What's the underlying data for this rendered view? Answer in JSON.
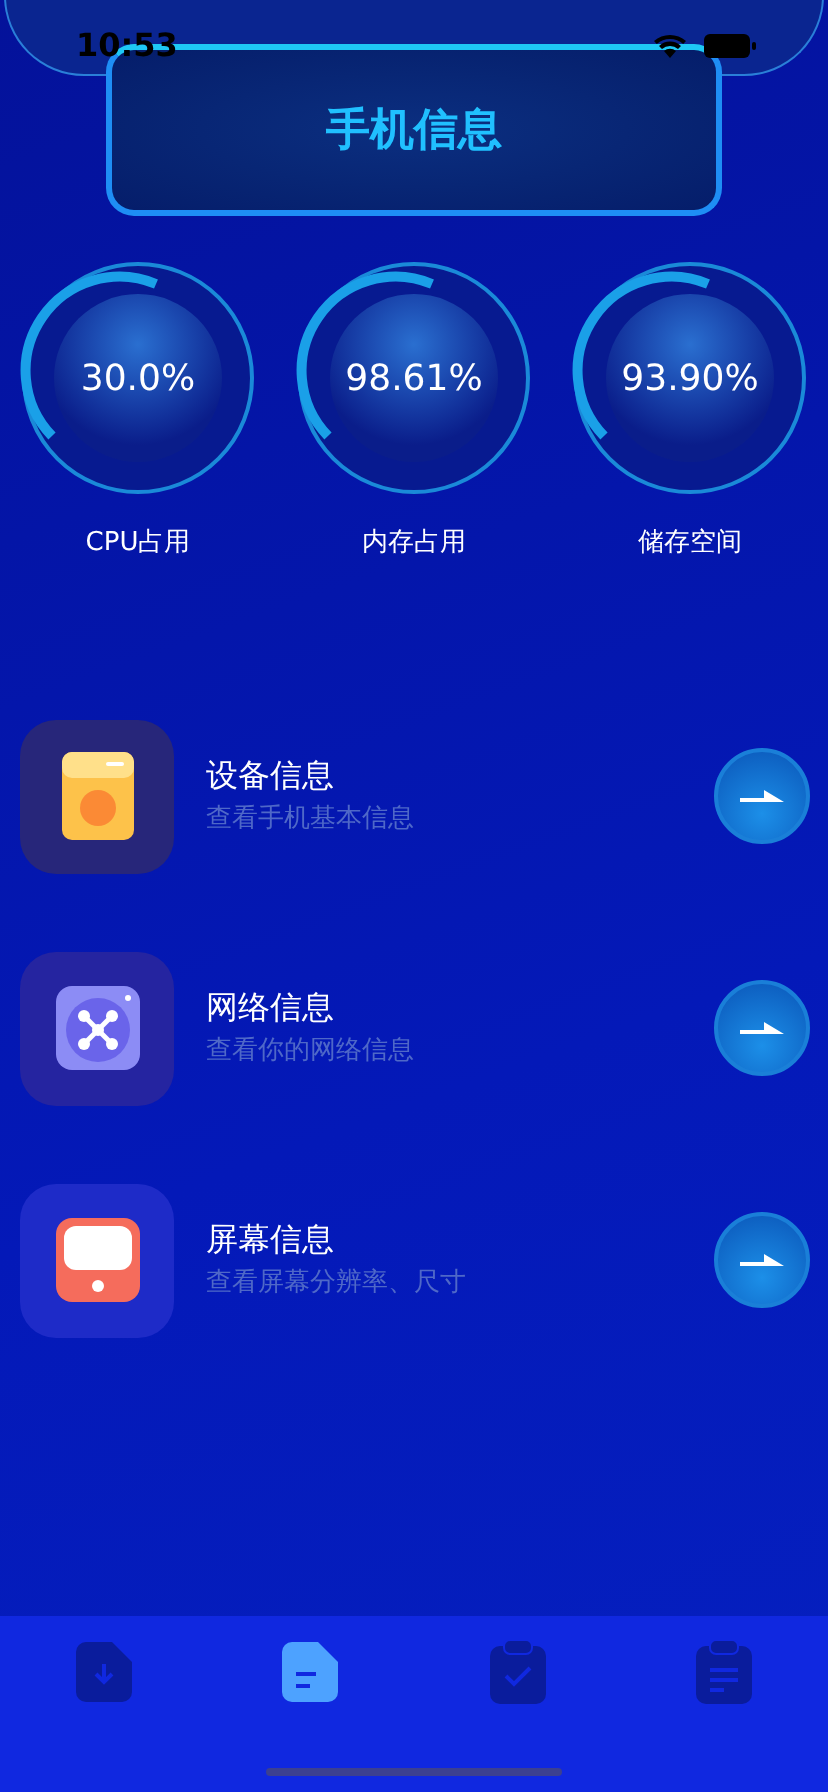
{
  "status_bar": {
    "time": "10:53"
  },
  "title": "手机信息",
  "gauges": [
    {
      "value": "30.0%",
      "label": "CPU占用"
    },
    {
      "value": "98.61%",
      "label": "内存占用"
    },
    {
      "value": "93.90%",
      "label": "储存空间"
    }
  ],
  "items": [
    {
      "kind": "device",
      "title": "设备信息",
      "subtitle": "查看手机基本信息"
    },
    {
      "kind": "network",
      "title": "网络信息",
      "subtitle": "查看你的网络信息"
    },
    {
      "kind": "screen",
      "title": "屏幕信息",
      "subtitle": "查看屏幕分辨率、尺寸"
    }
  ],
  "tabs": [
    {
      "kind": "download",
      "selected": false
    },
    {
      "kind": "document",
      "selected": true
    },
    {
      "kind": "check",
      "selected": false
    },
    {
      "kind": "list",
      "selected": false
    }
  ]
}
